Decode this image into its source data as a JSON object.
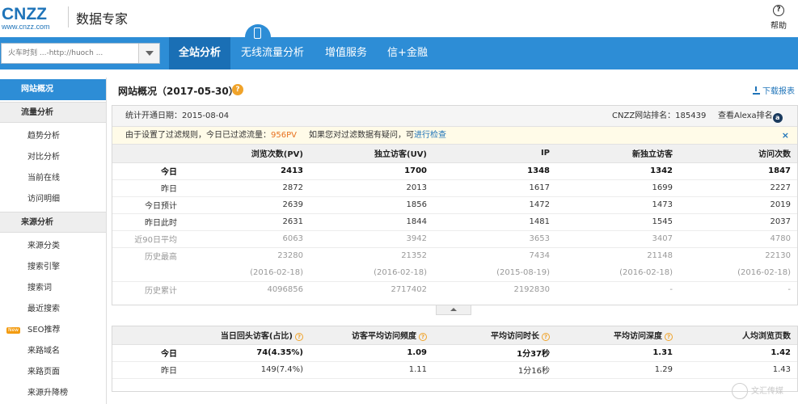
{
  "header": {
    "logo_main": "CNZZ",
    "logo_sub": "www.cnzz.com",
    "title": "数据专家",
    "help_label": "帮助",
    "help_icon": "?"
  },
  "search": {
    "placeholder": "火车时刻 ...-http://huoch ..."
  },
  "nav": {
    "tabs": [
      "全站分析",
      "无线流量分析",
      "增值服务",
      "信+金融"
    ],
    "active": "全站分析",
    "active_color": "#1a6fb5",
    "bar_color": "#2d8dd6"
  },
  "sidebar": {
    "items": [
      {
        "label": "网站概况",
        "kind": "active"
      },
      {
        "label": "流量分析",
        "kind": "head"
      },
      {
        "label": "趋势分析",
        "kind": "item"
      },
      {
        "label": "对比分析",
        "kind": "item"
      },
      {
        "label": "当前在线",
        "kind": "item"
      },
      {
        "label": "访问明细",
        "kind": "item"
      },
      {
        "label": "来源分析",
        "kind": "head"
      },
      {
        "label": "来源分类",
        "kind": "item"
      },
      {
        "label": "搜索引擎",
        "kind": "item"
      },
      {
        "label": "搜索词",
        "kind": "item"
      },
      {
        "label": "最近搜索",
        "kind": "item"
      },
      {
        "label": "SEO推荐",
        "kind": "item",
        "badge": "New"
      },
      {
        "label": "来路域名",
        "kind": "item"
      },
      {
        "label": "来路页面",
        "kind": "item"
      },
      {
        "label": "来源升降榜",
        "kind": "item"
      }
    ]
  },
  "main": {
    "title": "网站概况（2017-05-30）",
    "title_help": "?",
    "download_label": "下载报表",
    "stats_start": "统计开通日期：2015-08-04",
    "rank_text": "CNZZ网站排名：185439",
    "alexa_text": "查看Alexa排名",
    "alexa_icon": "a",
    "filter": {
      "prefix": "由于设置了过滤规则，今日已过滤流量：",
      "value": "956PV",
      "middle": "如果您对过滤数据有疑问，可",
      "link": "进行检查",
      "close": "×"
    }
  },
  "overview_table": {
    "headers": [
      "",
      "浏览次数(PV)",
      "独立访客(UV)",
      "IP",
      "新独立访客",
      "访问次数"
    ],
    "rows": [
      {
        "style": "bold",
        "cells": [
          "今日",
          "2413",
          "1700",
          "1348",
          "1342",
          "1847"
        ]
      },
      {
        "style": "",
        "cells": [
          "昨日",
          "2872",
          "2013",
          "1617",
          "1699",
          "2227"
        ]
      },
      {
        "style": "",
        "cells": [
          "今日预计",
          "2639",
          "1856",
          "1472",
          "1473",
          "2019"
        ]
      },
      {
        "style": "",
        "cells": [
          "昨日此时",
          "2631",
          "1844",
          "1481",
          "1545",
          "2037"
        ]
      },
      {
        "style": "grey",
        "cells": [
          "近90日平均",
          "6063",
          "3942",
          "3653",
          "3407",
          "4780"
        ]
      },
      {
        "style": "grey",
        "cells": [
          "历史最高",
          "23280",
          "21352",
          "7434",
          "21148",
          "22130"
        ]
      },
      {
        "style": "grey",
        "cells": [
          "",
          "(2016-02-18)",
          "(2016-02-18)",
          "(2015-08-19)",
          "(2016-02-18)",
          "(2016-02-18)"
        ]
      },
      {
        "style": "grey",
        "cells": [
          "历史累计",
          "4096856",
          "2717402",
          "2192830",
          "-",
          "-"
        ]
      }
    ]
  },
  "quality_table": {
    "headers": [
      "",
      "当日回头访客(占比)",
      "访客平均访问频度",
      "平均访问时长",
      "平均访问深度",
      "人均浏览页数"
    ],
    "help_columns": [
      1,
      2,
      3,
      4
    ],
    "rows": [
      {
        "style": "bold",
        "cells": [
          "今日",
          "74(4.35%)",
          "1.09",
          "1分37秒",
          "1.31",
          "1.42"
        ]
      },
      {
        "style": "",
        "cells": [
          "昨日",
          "149(7.4%)",
          "1.11",
          "1分16秒",
          "1.29",
          "1.43"
        ]
      }
    ]
  },
  "watermark": "文汇传媒"
}
